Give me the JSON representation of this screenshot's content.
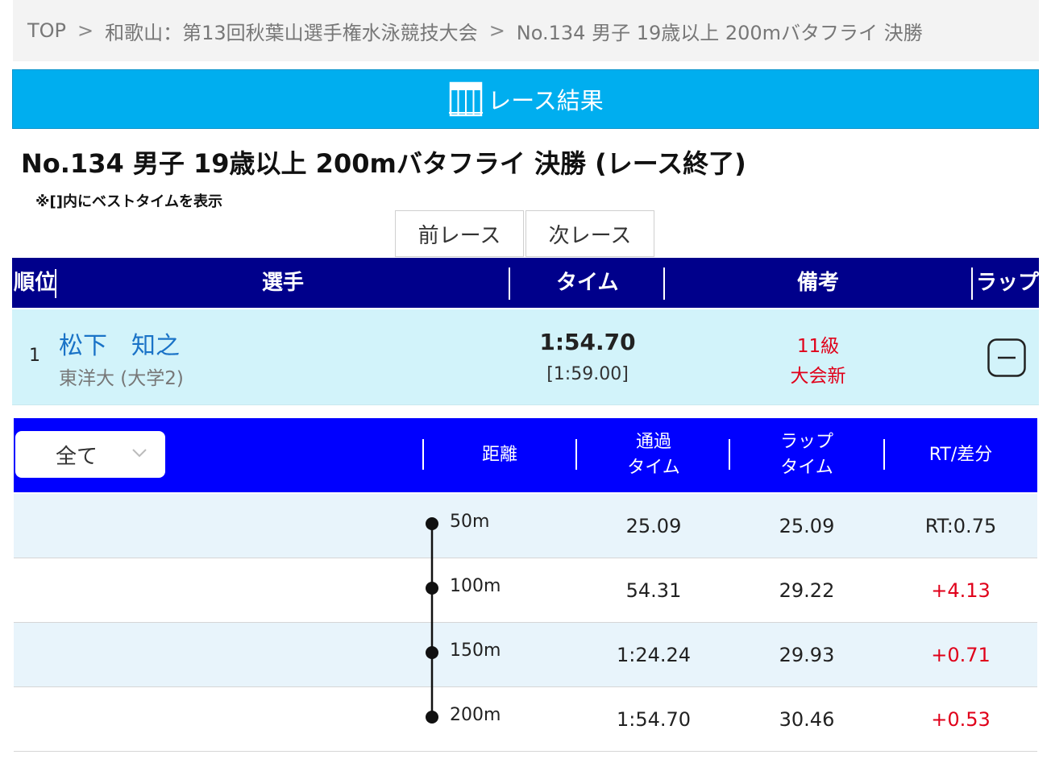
{
  "breadcrumb": {
    "items": [
      "TOP",
      "和歌山：第13回秋葉山選手権水泳競技大会",
      "No.134 男子 19歳以上 200mバタフライ 決勝"
    ],
    "separator": ">"
  },
  "banner": {
    "label": "レース結果",
    "icon": "pool-lanes-icon",
    "color": "#00aeef"
  },
  "race": {
    "title": "No.134 男子 19歳以上 200mバタフライ 決勝 (レース終了)",
    "note": "※[]内にベストタイムを表示",
    "prev_label": "前レース",
    "next_label": "次レース"
  },
  "results": {
    "headers": {
      "rank": "順位",
      "swimmer": "選手",
      "time": "タイム",
      "remarks": "備考",
      "lap": "ラップ"
    },
    "rows": [
      {
        "rank": "1",
        "name": "松下　知之",
        "team": "東洋大 (大学2)",
        "time": "1:54.70",
        "best": "[1:59.00]",
        "remark1": "11級",
        "remark2": "大会新",
        "toggle_icon": "collapse-minus-icon"
      }
    ]
  },
  "splits": {
    "filter": {
      "value": "全て",
      "icon": "chevron-down-icon"
    },
    "headers": {
      "distance": "距離",
      "pass_line1": "通過",
      "pass_line2": "タイム",
      "lap_line1": "ラップ",
      "lap_line2": "タイム",
      "rt": "RT/差分"
    },
    "rows": [
      {
        "distance": "50m",
        "pass": "25.09",
        "lap": "25.09",
        "rt": "RT:0.75",
        "highlight": true
      },
      {
        "distance": "100m",
        "pass": "54.31",
        "lap": "29.22",
        "rt": "+4.13",
        "highlight": false
      },
      {
        "distance": "150m",
        "pass": "1:24.24",
        "lap": "29.93",
        "rt": "+0.71",
        "highlight": false
      },
      {
        "distance": "200m",
        "pass": "1:54.70",
        "lap": "30.46",
        "rt": "+0.53",
        "highlight": false
      }
    ]
  },
  "colors": {
    "header_navy": "#00008b",
    "split_blue": "#0000ff",
    "row_highlight": "#d2f3fa",
    "split_alt": "#e8f4fb",
    "diff_red": "#e0001a",
    "name_blue": "#1a73c7"
  }
}
